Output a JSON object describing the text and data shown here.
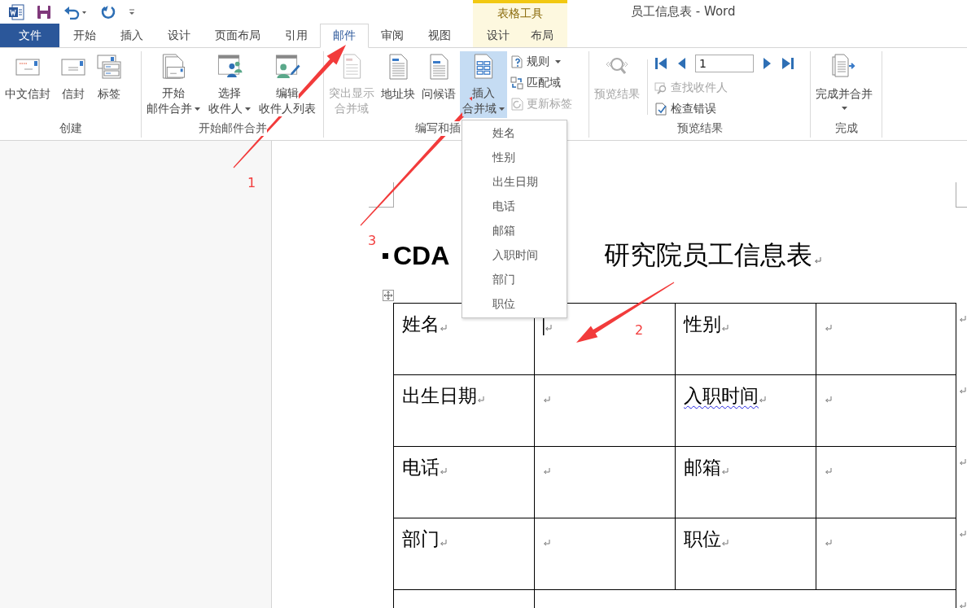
{
  "window": {
    "title": "员工信息表 - Word"
  },
  "contextual_tabs": {
    "label": "表格工具"
  },
  "tabs": [
    {
      "label": "文件",
      "kind": "file",
      "selected": false
    },
    {
      "label": "开始",
      "kind": "main",
      "selected": false
    },
    {
      "label": "插入",
      "kind": "main",
      "selected": false
    },
    {
      "label": "设计",
      "kind": "main",
      "selected": false
    },
    {
      "label": "页面布局",
      "kind": "main",
      "selected": false
    },
    {
      "label": "引用",
      "kind": "main",
      "selected": false
    },
    {
      "label": "邮件",
      "kind": "main",
      "selected": true
    },
    {
      "label": "审阅",
      "kind": "main",
      "selected": false
    },
    {
      "label": "视图",
      "kind": "main",
      "selected": false
    },
    {
      "label": "设计",
      "kind": "contextual",
      "selected": false
    },
    {
      "label": "布局",
      "kind": "contextual",
      "selected": false
    }
  ],
  "ribbon": {
    "groups": [
      {
        "label": "创建",
        "buttons": [
          {
            "lines": [
              "中文信封"
            ],
            "disabled": false,
            "menu": false,
            "highlighted": false
          },
          {
            "lines": [
              "信封"
            ],
            "disabled": false,
            "menu": false,
            "highlighted": false
          },
          {
            "lines": [
              "标签"
            ],
            "disabled": false,
            "menu": false,
            "highlighted": false
          }
        ]
      },
      {
        "label": "开始邮件合并",
        "buttons": [
          {
            "lines": [
              "开始",
              "邮件合并"
            ],
            "disabled": false,
            "menu": true,
            "highlighted": false
          },
          {
            "lines": [
              "选择",
              "收件人"
            ],
            "disabled": false,
            "menu": true,
            "highlighted": false
          },
          {
            "lines": [
              "编辑",
              "收件人列表"
            ],
            "disabled": false,
            "menu": false,
            "highlighted": false
          }
        ]
      },
      {
        "label": "编写和插",
        "buttons": [
          {
            "lines": [
              "突出显示",
              "合并域"
            ],
            "disabled": true,
            "menu": false,
            "highlighted": false
          },
          {
            "lines": [
              "地址块"
            ],
            "disabled": false,
            "menu": false,
            "highlighted": false
          },
          {
            "lines": [
              "问候语"
            ],
            "disabled": false,
            "menu": false,
            "highlighted": false
          },
          {
            "lines": [
              "插入",
              "合并域"
            ],
            "disabled": false,
            "menu": true,
            "highlighted": true
          }
        ],
        "small_buttons": [
          {
            "label": "规则",
            "disabled": false,
            "menu": true
          },
          {
            "label": "匹配域",
            "disabled": false,
            "menu": false
          },
          {
            "label": "更新标签",
            "disabled": true,
            "menu": false
          }
        ]
      },
      {
        "label": "预览结果",
        "buttons": [
          {
            "lines": [
              "预览结果"
            ],
            "disabled": true,
            "menu": false,
            "highlighted": false
          }
        ],
        "record": {
          "value": "1"
        },
        "small_buttons": [
          {
            "label": "查找收件人",
            "disabled": true,
            "menu": false
          },
          {
            "label": "检查错误",
            "disabled": false,
            "menu": false
          }
        ]
      },
      {
        "label": "完成",
        "buttons": [
          {
            "lines": [
              "完成并合并"
            ],
            "disabled": false,
            "menu": true,
            "highlighted": false
          }
        ]
      }
    ]
  },
  "insert_field_menu": {
    "items": [
      "姓名",
      "性别",
      "出生日期",
      "电话",
      "邮箱",
      "入职时间",
      "部门",
      "职位"
    ]
  },
  "document": {
    "heading": {
      "lead": "CDA",
      "rest": "研究院员工信息表"
    },
    "table": {
      "rows": [
        {
          "kind": "pairs",
          "cells": [
            {
              "label": "姓名",
              "flagged": false,
              "cursor": true
            },
            {
              "label": "性别",
              "flagged": false,
              "cursor": false
            }
          ]
        },
        {
          "kind": "pairs",
          "cells": [
            {
              "label": "出生日期",
              "flagged": false,
              "cursor": false
            },
            {
              "label": "入职时间",
              "flagged": true,
              "cursor": false
            }
          ]
        },
        {
          "kind": "pairs",
          "cells": [
            {
              "label": "电话",
              "flagged": false,
              "cursor": false
            },
            {
              "label": "邮箱",
              "flagged": false,
              "cursor": false
            }
          ]
        },
        {
          "kind": "pairs",
          "cells": [
            {
              "label": "部门",
              "flagged": false,
              "cursor": false
            },
            {
              "label": "职位",
              "flagged": false,
              "cursor": false
            }
          ]
        },
        {
          "kind": "span"
        }
      ]
    }
  },
  "annotations": [
    {
      "label": "1"
    },
    {
      "label": "3"
    },
    {
      "label": "2"
    }
  ]
}
